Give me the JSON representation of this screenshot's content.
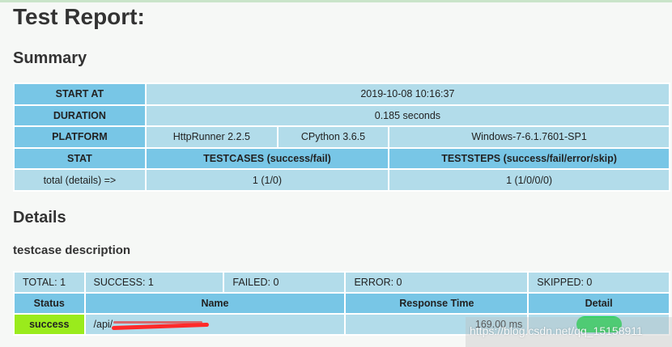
{
  "title": "Test Report:",
  "summary": {
    "heading": "Summary",
    "start_at_label": "START AT",
    "start_at_value": "2019-10-08 10:16:37",
    "duration_label": "DURATION",
    "duration_value": "0.185 seconds",
    "platform_label": "PLATFORM",
    "platform_httprunner": "HttpRunner 2.2.5",
    "platform_python": "CPython 3.6.5",
    "platform_os": "Windows-7-6.1.7601-SP1",
    "stat_label": "STAT",
    "testcases_label": "TESTCASES (success/fail)",
    "teststeps_label": "TESTSTEPS (success/fail/error/skip)",
    "total_label": "total (details) =>",
    "testcases_value": "1 (1/0)",
    "teststeps_value": "1 (1/0/0/0)"
  },
  "details": {
    "heading": "Details",
    "testcase_heading": "testcase description",
    "total": "TOTAL: 1",
    "success": "SUCCESS: 1",
    "failed": "FAILED: 0",
    "error": "ERROR: 0",
    "skipped": "SKIPPED: 0",
    "columns": {
      "status": "Status",
      "name": "Name",
      "response_time": "Response Time",
      "detail": "Detail"
    },
    "rows": [
      {
        "status": "success",
        "name": "/api/",
        "response_time": "169.00 ms"
      }
    ]
  },
  "watermark": "https://blog.csdn.net/qq_15158911",
  "colors": {
    "header_bg": "#78c6e6",
    "value_bg": "#b2dcea",
    "success_bg": "#9aeb1c",
    "log_button": "#14d34e"
  }
}
